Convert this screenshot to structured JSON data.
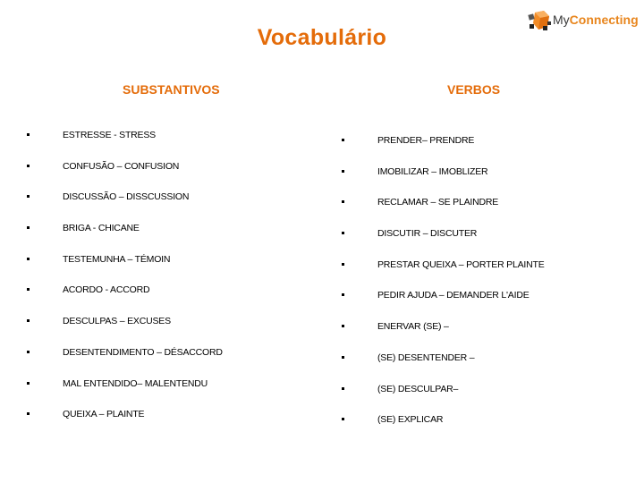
{
  "title": "Vocabulário",
  "logo": {
    "icon": "cube-logo-icon",
    "text_my": "My",
    "text_connecting": "Connecting",
    "brand_color": "#e8861e"
  },
  "accent_color": "#e46c0a",
  "substantivos": {
    "heading": "SUBSTANTIVOS",
    "items": [
      "ESTRESSE - STRESS",
      "CONFUSÃO  – CONFUSION",
      "DISCUSSÃO – DISSCUSSION",
      "BRIGA - CHICANE",
      "TESTEMUNHA – TÉMOIN",
      "ACORDO  - ACCORD",
      "DESCULPAS – EXCUSES",
      "DESENTENDIMENTO – DÉSACCORD",
      "MAL ENTENDIDO– MALENTENDU",
      "QUEIXA – PLAINTE"
    ]
  },
  "verbos": {
    "heading": "VERBOS",
    "items": [
      "PRENDER– PRENDRE",
      "IMOBILIZAR – IMOBLIZER",
      "RECLAMAR – SE PLAINDRE",
      "DISCUTIR  – DISCUTER",
      "PRESTAR QUEIXA – PORTER PLAINTE",
      "PEDIR AJUDA – DEMANDER L'AIDE",
      "ENERVAR (SE) –",
      "(SE) DESENTENDER  –",
      "(SE) DESCULPAR–",
      "(SE) EXPLICAR"
    ]
  }
}
